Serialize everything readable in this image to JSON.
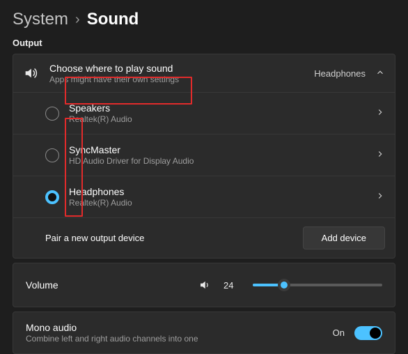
{
  "breadcrumb": {
    "parent": "System",
    "separator": "›",
    "current": "Sound"
  },
  "sections": {
    "output": "Output"
  },
  "output_header": {
    "title": "Choose where to play sound",
    "subtitle": "Apps might have their own settings",
    "current": "Headphones"
  },
  "devices": [
    {
      "name": "Speakers",
      "driver": "Realtek(R) Audio",
      "selected": false
    },
    {
      "name": "SyncMaster",
      "driver": "HD Audio Driver for Display Audio",
      "selected": false
    },
    {
      "name": "Headphones",
      "driver": "Realtek(R) Audio",
      "selected": true
    }
  ],
  "pair": {
    "label": "Pair a new output device",
    "button": "Add device"
  },
  "volume": {
    "label": "Volume",
    "value": "24",
    "percent": 24
  },
  "mono": {
    "title": "Mono audio",
    "subtitle": "Combine left and right audio channels into one",
    "state": "On",
    "on": true
  },
  "colors": {
    "accent": "#4cc2ff",
    "highlight": "#e22b2b"
  }
}
